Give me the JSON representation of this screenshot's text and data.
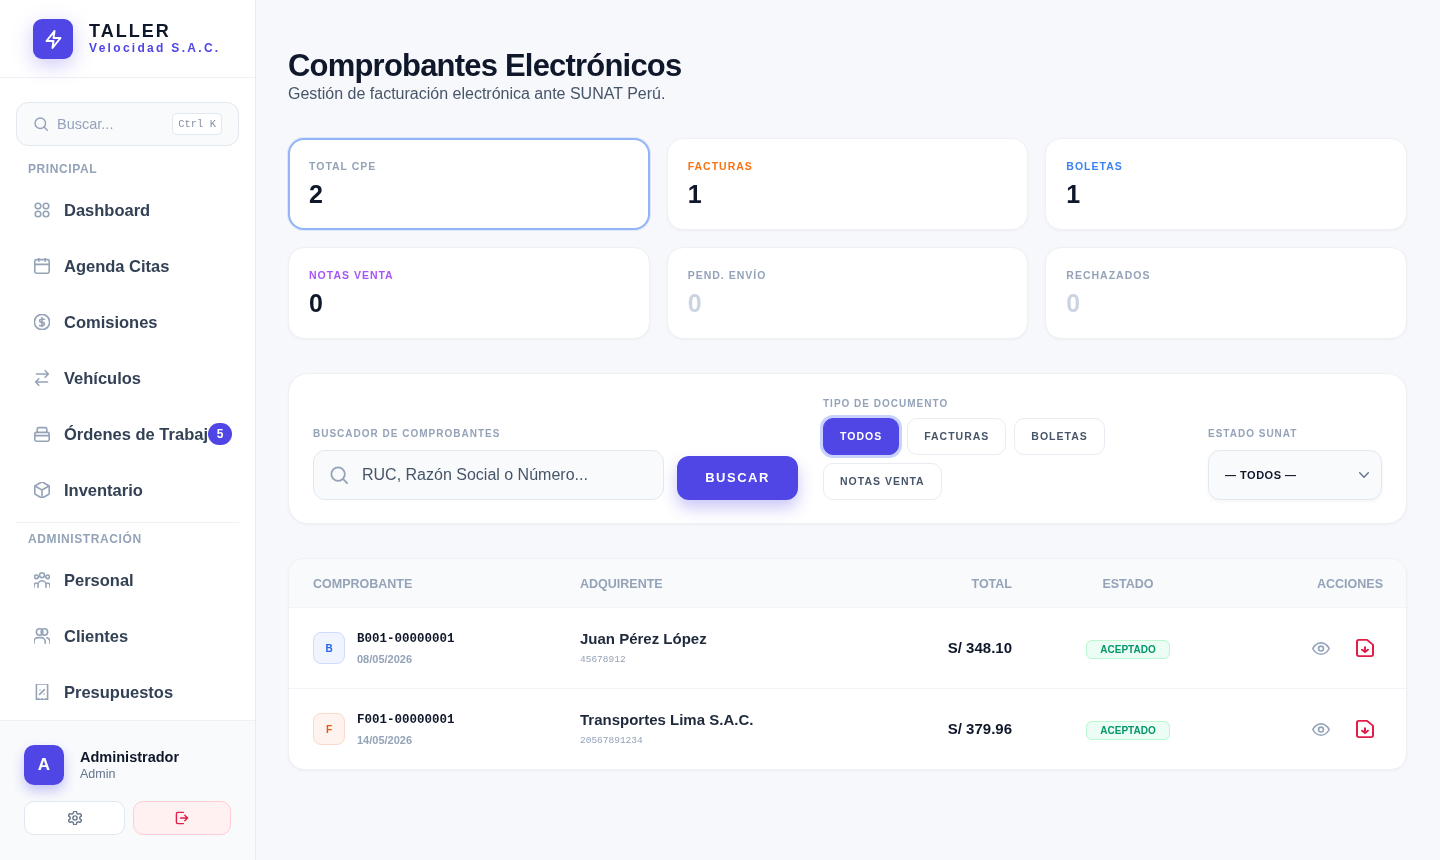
{
  "sidebar": {
    "brand": {
      "title": "TALLER",
      "subtitle": "Velocidad S.A.C."
    },
    "search": {
      "placeholder": "Buscar...",
      "shortcut": "Ctrl K"
    },
    "sections": [
      {
        "title": "PRINCIPAL",
        "items": [
          {
            "label": "Dashboard"
          },
          {
            "label": "Agenda Citas"
          },
          {
            "label": "Comisiones"
          },
          {
            "label": "Vehículos"
          },
          {
            "label": "Órdenes de Trabaj",
            "badge": "5"
          },
          {
            "label": "Inventario"
          }
        ]
      },
      {
        "title": "ADMINISTRACIÓN",
        "items": [
          {
            "label": "Personal"
          },
          {
            "label": "Clientes"
          },
          {
            "label": "Presupuestos"
          }
        ]
      }
    ],
    "user": {
      "initial": "A",
      "name": "Administrador",
      "role": "Admin"
    }
  },
  "header": {
    "title": "Comprobantes Electrónicos",
    "subtitle": "Gestión de facturación electrónica ante SUNAT Perú."
  },
  "stats": [
    {
      "label": "TOTAL CPE",
      "value": "2",
      "color": "#94a3b8",
      "selected": true,
      "dimmed": false
    },
    {
      "label": "FACTURAS",
      "value": "1",
      "color": "#f97316",
      "selected": false,
      "dimmed": false
    },
    {
      "label": "BOLETAS",
      "value": "1",
      "color": "#3b82f6",
      "selected": false,
      "dimmed": false
    },
    {
      "label": "NOTAS VENTA",
      "value": "0",
      "color": "#a855f7",
      "selected": false,
      "dimmed": false
    },
    {
      "label": "PEND. ENVÍO",
      "value": "0",
      "color": "#94a3b8",
      "selected": false,
      "dimmed": true
    },
    {
      "label": "RECHAZADOS",
      "value": "0",
      "color": "#94a3b8",
      "selected": false,
      "dimmed": true
    }
  ],
  "filters": {
    "search": {
      "label": "BUSCADOR DE COMPROBANTES",
      "placeholder": "RUC, Razón Social o Número..."
    },
    "search_button": "BUSCAR",
    "doc_type": {
      "label": "TIPO DE DOCUMENTO",
      "options": [
        {
          "label": "TODOS",
          "selected": true
        },
        {
          "label": "FACTURAS",
          "selected": false
        },
        {
          "label": "BOLETAS",
          "selected": false
        },
        {
          "label": "NOTAS VENTA",
          "selected": false
        }
      ]
    },
    "status": {
      "label": "ESTADO SUNAT",
      "value": "— TODOS —"
    }
  },
  "table": {
    "columns": [
      "COMPROBANTE",
      "ADQUIRENTE",
      "TOTAL",
      "ESTADO",
      "ACCIONES"
    ],
    "rows": [
      {
        "type": "B",
        "color": "#2563eb",
        "number": "B001-00000001",
        "date": "08/05/2026",
        "client": "Juan Pérez López",
        "client_id": "45678912",
        "total": "S/ 348.10",
        "status": "ACEPTADO"
      },
      {
        "type": "F",
        "color": "#ea580c",
        "number": "F001-00000001",
        "date": "14/05/2026",
        "client": "Transportes Lima S.A.C.",
        "client_id": "20567891234",
        "total": "S/ 379.96",
        "status": "ACEPTADO"
      }
    ]
  }
}
